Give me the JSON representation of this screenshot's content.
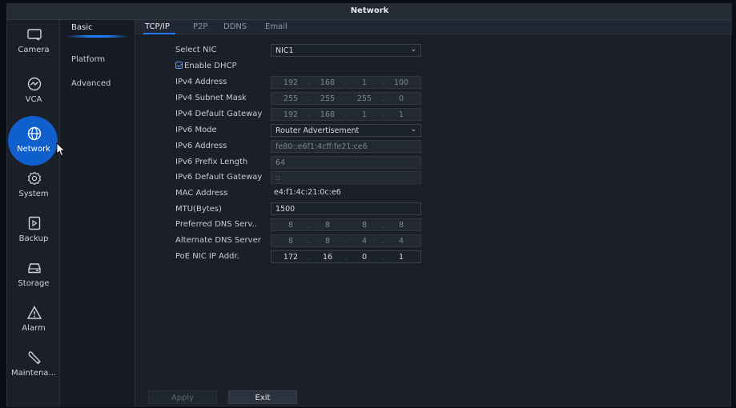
{
  "window": {
    "title": "Network"
  },
  "sidebar": {
    "items": [
      {
        "label": "Camera",
        "icon": "camera-icon"
      },
      {
        "label": "VCA",
        "icon": "vca-icon"
      },
      {
        "label": "Network",
        "icon": "globe-icon",
        "active": true
      },
      {
        "label": "System",
        "icon": "gear-icon"
      },
      {
        "label": "Backup",
        "icon": "backup-icon"
      },
      {
        "label": "Storage",
        "icon": "storage-icon"
      },
      {
        "label": "Alarm",
        "icon": "alarm-icon"
      },
      {
        "label": "Maintena...",
        "icon": "wrench-icon"
      }
    ]
  },
  "submenu": {
    "items": [
      {
        "label": "Basic",
        "active": true
      },
      {
        "label": "Platform"
      },
      {
        "label": "Advanced"
      }
    ]
  },
  "tabs": [
    {
      "label": "TCP/IP",
      "active": true
    },
    {
      "label": "P2P"
    },
    {
      "label": "DDNS"
    },
    {
      "label": "Email"
    }
  ],
  "form": {
    "select_nic": {
      "label": "Select NIC",
      "value": "NIC1"
    },
    "enable_dhcp": {
      "label": "Enable DHCP",
      "checked": true
    },
    "ipv4_address": {
      "label": "IPv4 Address",
      "octets": [
        "192",
        "168",
        "1",
        "100"
      ]
    },
    "ipv4_subnet_mask": {
      "label": "IPv4 Subnet Mask",
      "octets": [
        "255",
        "255",
        "255",
        "0"
      ]
    },
    "ipv4_gateway": {
      "label": "IPv4 Default Gateway",
      "octets": [
        "192",
        "168",
        "1",
        "1"
      ]
    },
    "ipv6_mode": {
      "label": "IPv6 Mode",
      "value": "Router Advertisement"
    },
    "ipv6_address": {
      "label": "IPv6 Address",
      "value": "fe80::e6f1:4cff:fe21:ce6"
    },
    "ipv6_prefix_length": {
      "label": "IPv6 Prefix Length",
      "value": "64"
    },
    "ipv6_gateway": {
      "label": "IPv6 Default Gateway",
      "value": "::"
    },
    "mac_address": {
      "label": "MAC Address",
      "value": "e4:f1:4c:21:0c:e6"
    },
    "mtu": {
      "label": "MTU(Bytes)",
      "value": "1500"
    },
    "preferred_dns": {
      "label": "Preferred DNS Serv..",
      "octets": [
        "8",
        "8",
        "8",
        "8"
      ]
    },
    "alternate_dns": {
      "label": "Alternate DNS Server",
      "octets": [
        "8",
        "8",
        "4",
        "4"
      ]
    },
    "poe_nic_ip": {
      "label": "PoE NIC IP Addr.",
      "octets": [
        "172",
        "16",
        "0",
        "1"
      ]
    }
  },
  "buttons": {
    "apply": "Apply",
    "exit": "Exit"
  },
  "colors": {
    "accent": "#1f7cf0",
    "active_bubble": "#0f5fcc",
    "background": "#1a1f28"
  }
}
